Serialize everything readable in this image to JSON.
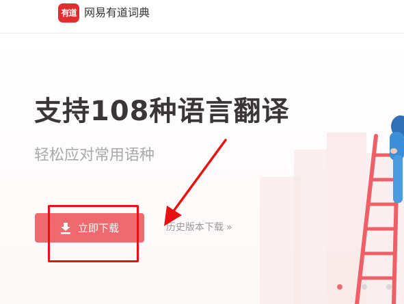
{
  "header": {
    "logo_text": "有道",
    "brand_name": "网易有道词典"
  },
  "hero": {
    "title": "支持108种语言翻译",
    "subtitle": "轻松应对常用语种",
    "download_button": "立即下载",
    "history_link": "历史版本下载",
    "history_chevron": "»"
  },
  "carousel": {
    "active_index": 0,
    "slide_count": 3
  },
  "colors": {
    "brand_red": "#e02e2e",
    "button": "#ee6a6f",
    "annotation": "#e81010"
  }
}
